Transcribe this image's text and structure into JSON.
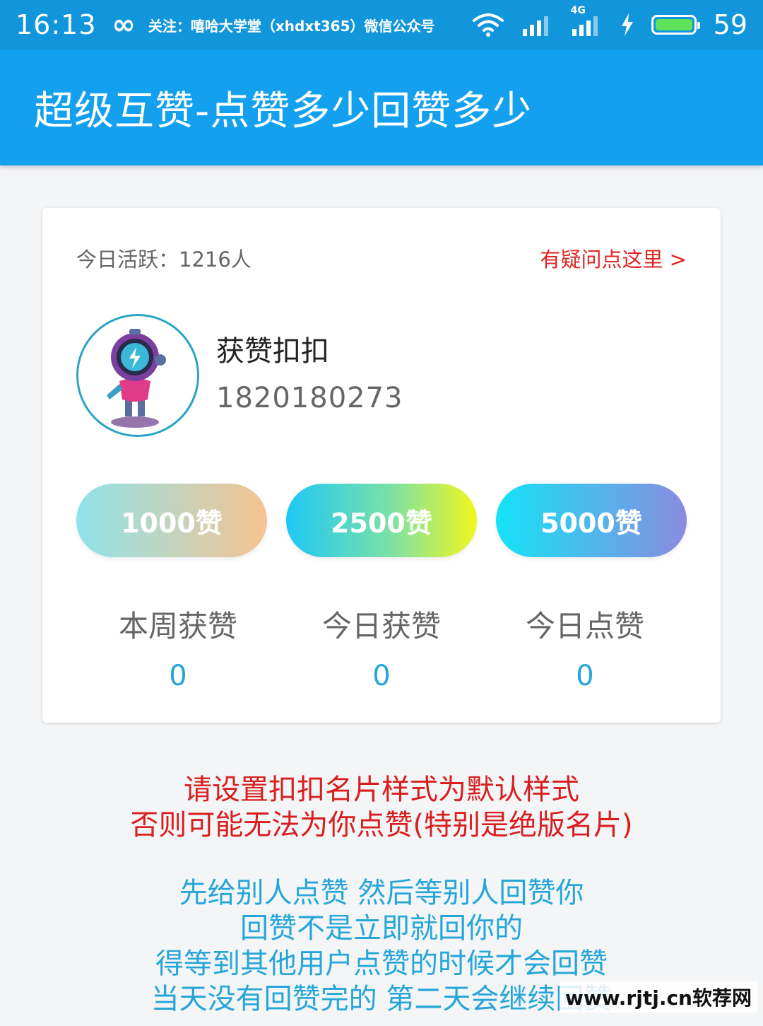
{
  "status_bar": {
    "time": "16:13",
    "infinity_glyph": "∞",
    "notice": "关注：嘻哈大学堂（xhdxt365）微信公众号",
    "network_label": "4G",
    "battery_level": "59"
  },
  "app_bar": {
    "title": "超级互赞-点赞多少回赞多少"
  },
  "card": {
    "active_today": "今日活跃：1216人",
    "help_link": "有疑问点这里 >",
    "user": {
      "name": "获赞扣扣",
      "id": "1820180273"
    },
    "packages": [
      {
        "label": "1000赞"
      },
      {
        "label": "2500赞"
      },
      {
        "label": "5000赞"
      }
    ],
    "stats": [
      {
        "label": "本周获赞",
        "value": "0"
      },
      {
        "label": "今日获赞",
        "value": "0"
      },
      {
        "label": "今日点赞",
        "value": "0"
      }
    ]
  },
  "notices": {
    "red_lines": [
      "请设置扣扣名片样式为默认样式",
      "否则可能无法为你点赞(特别是绝版名片)"
    ],
    "blue_lines": [
      "先给别人点赞 然后等别人回赞你",
      "回赞不是立即就回你的",
      "得等到其他用户点赞的时候才会回赞",
      "当天没有回赞完的 第二天会继续回赞"
    ]
  },
  "watermark": "www.rjtj.cn软荐网",
  "colors": {
    "status_bar": "#1296db",
    "app_bar": "#12a0ef",
    "help_link": "#e02424",
    "stat_value": "#26a6d8",
    "notice_red": "#d81e1e",
    "notice_blue": "#26a6d8"
  },
  "icons": [
    "infinity-icon",
    "wifi-icon",
    "signal-icon",
    "signal-4g-icon",
    "charging-icon",
    "battery-icon"
  ]
}
